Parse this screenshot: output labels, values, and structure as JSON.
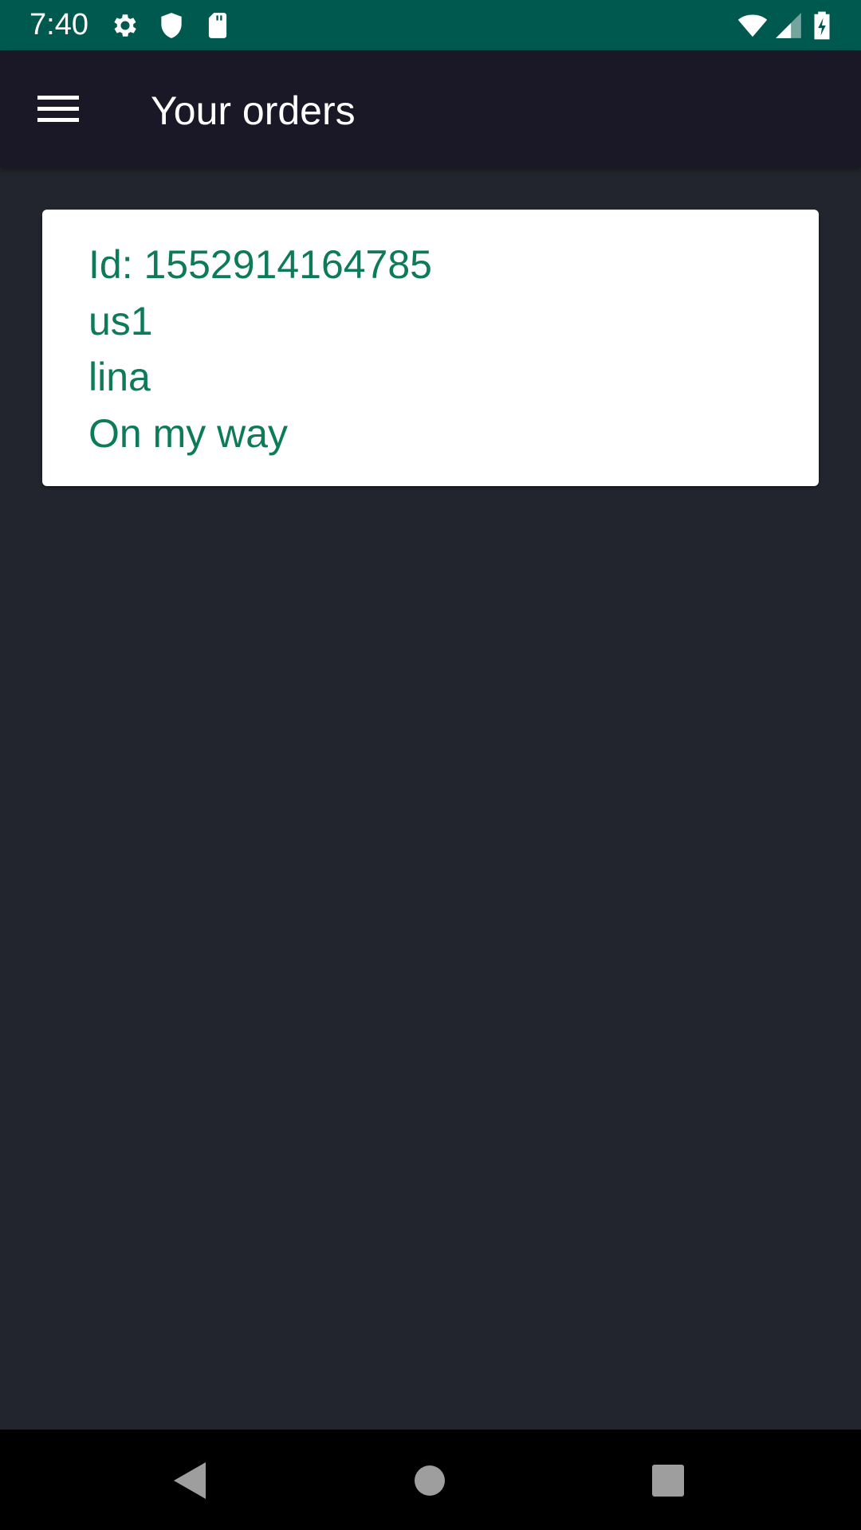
{
  "status_bar": {
    "time": "7:40",
    "icons_left": [
      "settings-icon",
      "shield-icon",
      "sd-card-icon"
    ],
    "icons_right": [
      "wifi-icon",
      "signal-icon",
      "battery-charging-icon"
    ],
    "background": "#00594e"
  },
  "app_bar": {
    "title": "Your orders",
    "menu_icon": "hamburger-menu-icon",
    "background": "#1a1726"
  },
  "orders": [
    {
      "id_line": "Id: 1552914164785",
      "user": "us1",
      "name": "lina",
      "status": "On my way"
    }
  ],
  "colors": {
    "screen_background": "#23252e",
    "card_background": "#ffffff",
    "order_text": "#0d7a5a"
  },
  "nav_bar": {
    "buttons": [
      "back-icon",
      "home-icon",
      "recents-icon"
    ]
  }
}
